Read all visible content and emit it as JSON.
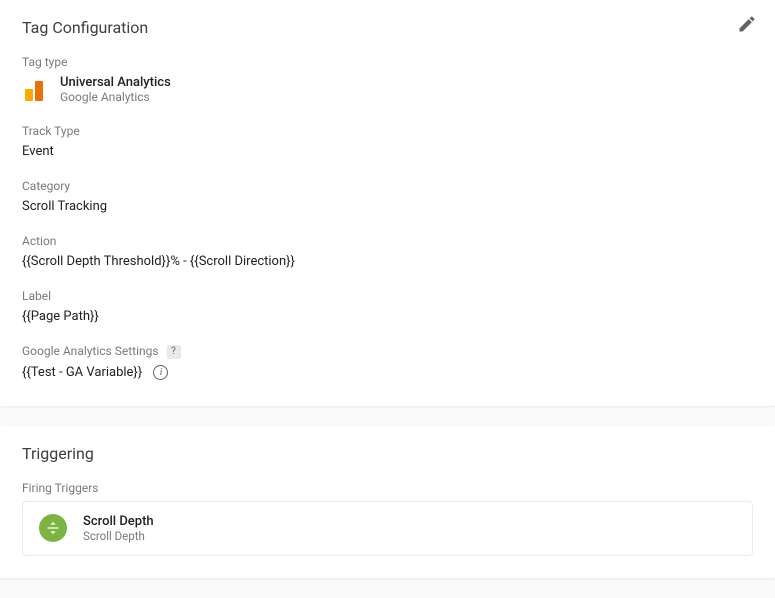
{
  "tagConfig": {
    "title": "Tag Configuration",
    "tagTypeLabel": "Tag type",
    "tagType": {
      "name": "Universal Analytics",
      "provider": "Google Analytics"
    },
    "trackTypeLabel": "Track Type",
    "trackType": "Event",
    "categoryLabel": "Category",
    "category": "Scroll Tracking",
    "actionLabel": "Action",
    "action": "{{Scroll Depth Threshold}}% - {{Scroll Direction}}",
    "labelLabel": "Label",
    "label": "{{Page Path}}",
    "gaSettingsLabel": "Google Analytics Settings",
    "gaSettings": "{{Test - GA Variable}}"
  },
  "triggering": {
    "title": "Triggering",
    "firingLabel": "Firing Triggers",
    "trigger": {
      "name": "Scroll Depth",
      "type": "Scroll Depth"
    }
  }
}
